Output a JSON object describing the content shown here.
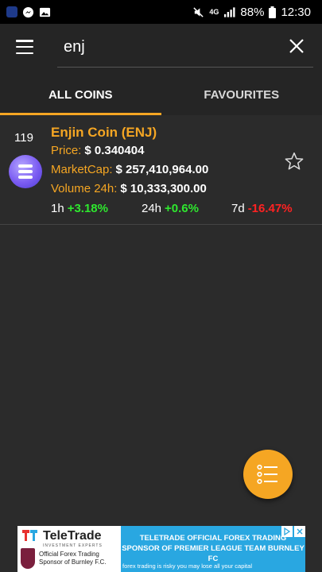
{
  "status_bar": {
    "network": "4G",
    "battery": "88%",
    "time": "12:30"
  },
  "search": {
    "value": "enj"
  },
  "tabs": [
    {
      "label": "ALL COINS",
      "active": true
    },
    {
      "label": "FAVOURITES",
      "active": false
    }
  ],
  "coin": {
    "rank": "119",
    "name": "Enjin Coin (ENJ)",
    "price_label": "Price:",
    "price_value": "$ 0.340404",
    "marketcap_label": "MarketCap:",
    "marketcap_value": "$ 257,410,964.00",
    "volume_label": "Volume 24h:",
    "volume_value": "$ 10,333,300.00",
    "change_1h_label": "1h",
    "change_1h_value": "+3.18%",
    "change_24h_label": "24h",
    "change_24h_value": "+0.6%",
    "change_7d_label": "7d",
    "change_7d_value": "-16.47%"
  },
  "ad": {
    "brand": "TeleTrade",
    "brand_sub": "INVESTMENT EXPERTS",
    "sponsor_text": "Official Forex Trading Sponsor of Burnley F.C.",
    "title": "TELETRADE OFFICIAL FOREX TRADING SPONSOR OF PREMIER LEAGUE TEAM BURNLEY FC",
    "warning": "forex trading is risky you may lose all your capital"
  },
  "colors": {
    "accent": "#f5a623",
    "positive": "#2ee82e",
    "negative": "#ff2222",
    "background": "#2b2b2b",
    "appbar": "#252525"
  },
  "icons": {
    "menu": "hamburger-menu-icon",
    "close": "close-icon",
    "favourite": "star-outline-icon",
    "fab": "list-icon"
  }
}
